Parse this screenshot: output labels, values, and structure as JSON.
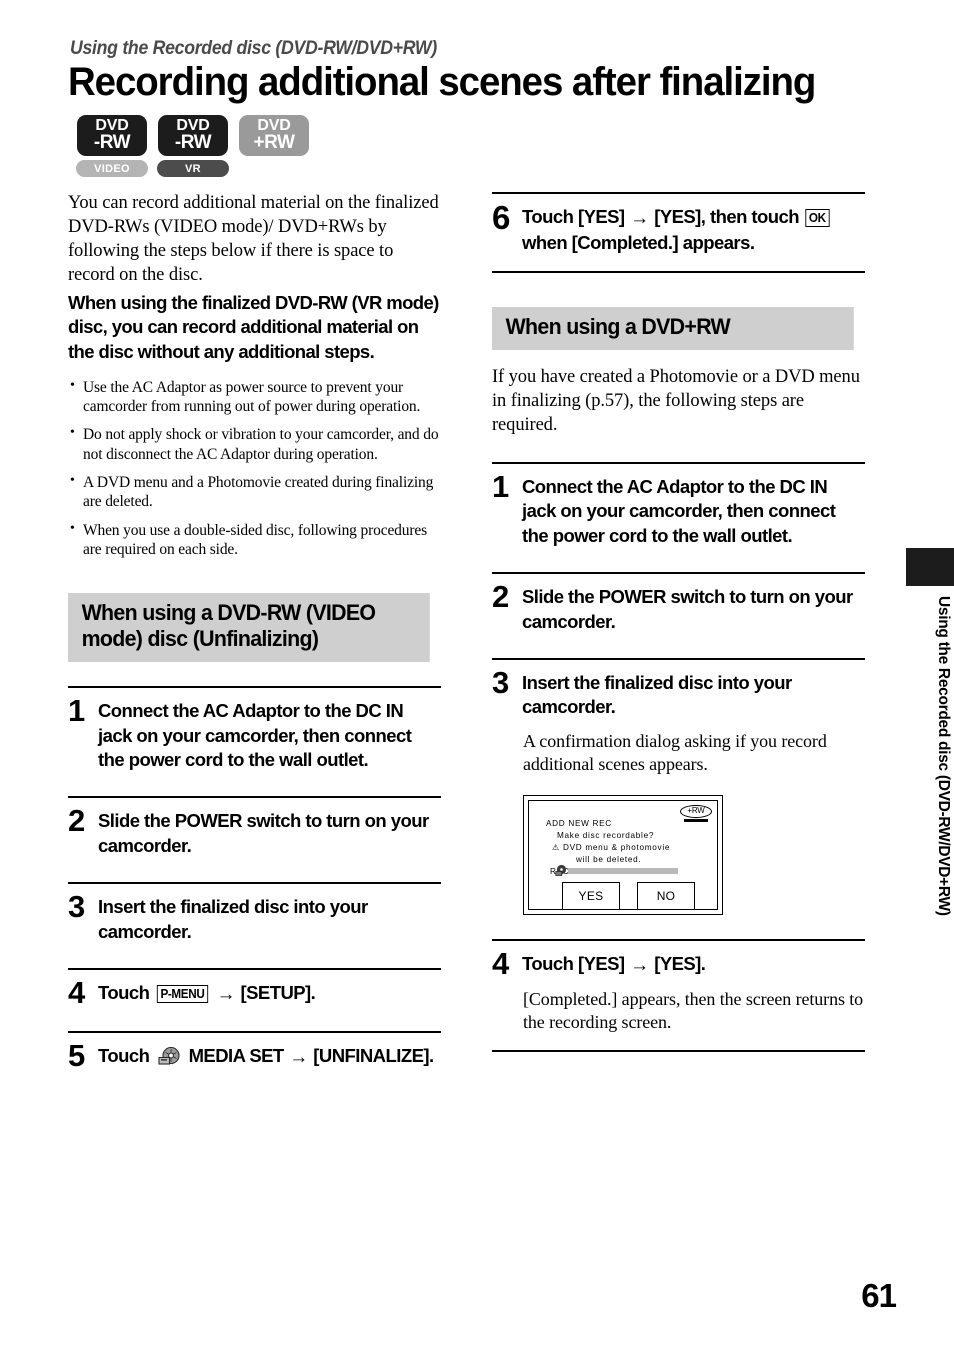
{
  "header": {
    "kicker": "Using the Recorded disc (DVD-RW/DVD+RW)",
    "title": "Recording additional scenes after finalizing"
  },
  "badges": [
    {
      "line1": "DVD",
      "line2": "-RW",
      "style": "dark",
      "pill": "VIDEO",
      "pill_style": "light"
    },
    {
      "line1": "DVD",
      "line2": "-RW",
      "style": "dark",
      "pill": "VR",
      "pill_style": "mid"
    },
    {
      "line1": "DVD",
      "line2": "+RW",
      "style": "gray",
      "pill": "",
      "pill_style": ""
    }
  ],
  "intro": {
    "paragraph": "You can record additional material on the finalized DVD-RWs (VIDEO mode)/ DVD+RWs by following the steps below if there is space to record on the disc.",
    "bold_paragraph": "When using the finalized DVD-RW (VR mode) disc, you can record additional material on the disc without any additional steps.",
    "notes": [
      "Use the AC Adaptor as power source to prevent your camcorder from running out of power during operation.",
      "Do not apply shock or vibration to your camcorder, and do not disconnect the AC Adaptor during operation.",
      "A DVD menu and a Photomovie created during finalizing are deleted.",
      "When you use a double-sided disc, following procedures are required on each side."
    ]
  },
  "section_dvdrw": {
    "heading": "When using a DVD-RW (VIDEO mode) disc (Unfinalizing)",
    "steps": [
      {
        "num": "1",
        "text": "Connect the AC Adaptor to the DC IN jack on your camcorder, then connect the power cord to the wall outlet."
      },
      {
        "num": "2",
        "text": "Slide the POWER switch to turn on your camcorder."
      },
      {
        "num": "3",
        "text": "Insert the finalized disc into your camcorder."
      },
      {
        "num": "4",
        "text_before": "Touch",
        "keybox": "P-MENU",
        "arrow": "→",
        "text_after": "[SETUP]."
      },
      {
        "num": "5",
        "text_before": "Touch",
        "icon": "disc-media-icon",
        "text_mid": "MEDIA SET",
        "arrow": "→",
        "text_after": "[UNFINALIZE]."
      },
      {
        "num": "6",
        "text_before": "Touch [YES]",
        "arrow": "→",
        "text_mid": "[YES], then touch",
        "keybox": "OK",
        "text_after": "when [Completed.] appears."
      }
    ]
  },
  "section_dvdplusrw": {
    "heading": "When using a DVD+RW",
    "intro": "If you have created a Photomovie or a DVD menu in finalizing (p.57), the following steps are required.",
    "steps": [
      {
        "num": "1",
        "text": "Connect the AC Adaptor to the DC IN jack on your camcorder, then connect the power cord to the wall outlet."
      },
      {
        "num": "2",
        "text": "Slide the POWER switch to turn on your camcorder."
      },
      {
        "num": "3",
        "text": "Insert the finalized disc into your camcorder.",
        "sub": "A confirmation dialog asking if you record additional scenes appears."
      },
      {
        "num": "4",
        "text_before": "Touch [YES]",
        "arrow": "→",
        "text_after": "[YES].",
        "sub": "[Completed.] appears, then the screen returns to the recording screen."
      }
    ]
  },
  "dialog_screenshot": {
    "badge": "+RW",
    "title": "ADD NEW REC",
    "line1": "Make disc recordable?",
    "line2": "DVD menu & photomovie",
    "line3": "will be deleted.",
    "line4": "RECORDED AREA",
    "warning_glyph": "⚠",
    "yes_button": "YES",
    "no_button": "NO"
  },
  "side_tab": {
    "label": "Using the Recorded disc (DVD-RW/DVD+RW)"
  },
  "footer": {
    "page_number": "61"
  },
  "colors": {
    "heading_bar": "#cfcfcf",
    "badge_dark": "#1c1c1c",
    "badge_gray": "#9a9a9a",
    "pill_light": "#b4b4b4",
    "pill_mid": "#4c4c4c"
  }
}
